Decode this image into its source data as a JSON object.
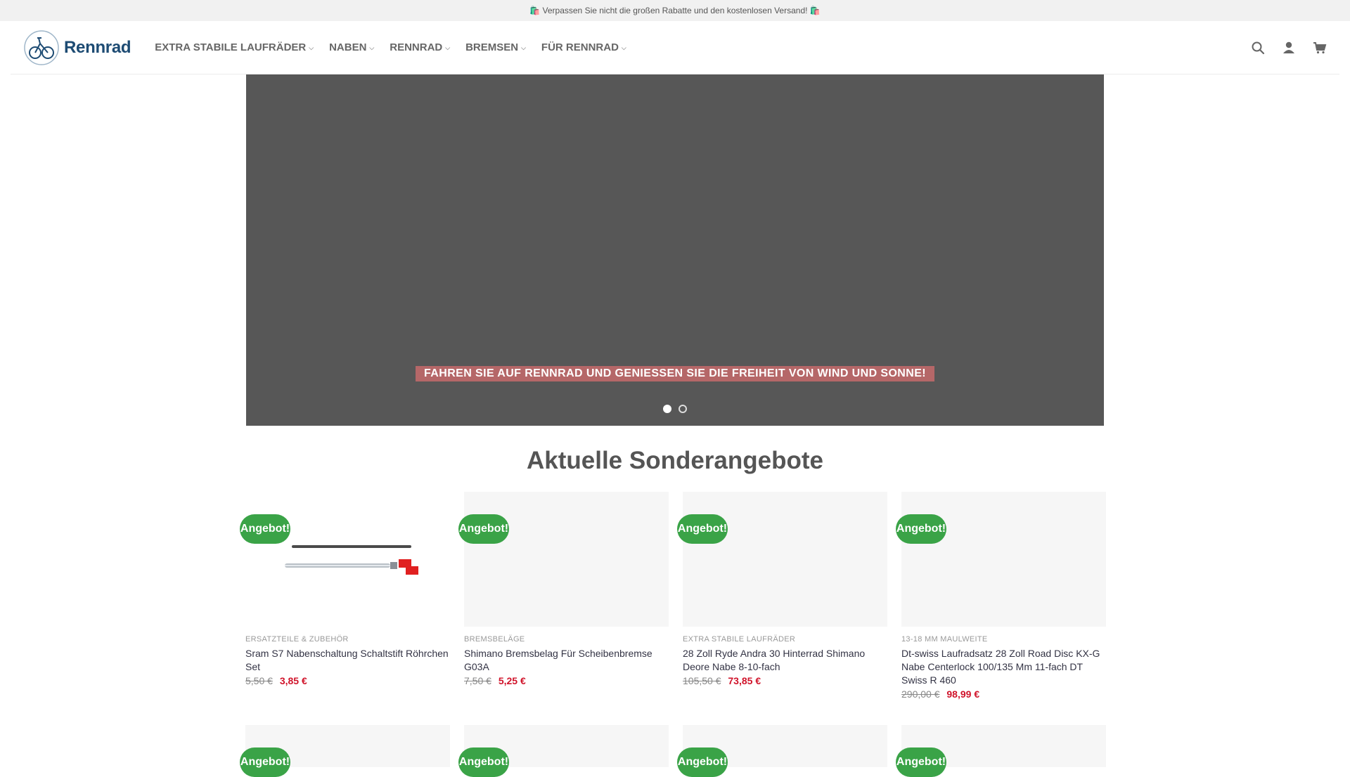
{
  "topbar": {
    "message": "🛍️ Verpassen Sie nicht die großen Rabatte und den kostenlosen Versand! 🛍️"
  },
  "logo": {
    "text": "Rennrad"
  },
  "nav": [
    {
      "label": "EXTRA STABILE LAUFRÄDER"
    },
    {
      "label": "NABEN"
    },
    {
      "label": "RENNRAD"
    },
    {
      "label": "BREMSEN"
    },
    {
      "label": "FÜR RENNRAD"
    }
  ],
  "header_icons": [
    "search-icon",
    "user-icon",
    "cart-icon"
  ],
  "hero": {
    "caption": "FAHREN SIE AUF RENNRAD UND GENIESSEN SIE DIE FREIHEIT VON WIND UND SONNE!",
    "slides": 2,
    "active_slide": 1
  },
  "section": {
    "title": "Aktuelle Sonderangebote"
  },
  "products": [
    {
      "badge": "Angebot!",
      "category": "ERSATZTEILE & ZUBEHÖR",
      "name": "Sram S7 Nabenschaltung Schaltstift Röhrchen Set",
      "old_price": "5,50 €",
      "new_price": "3,85 €"
    },
    {
      "badge": "Angebot!",
      "category": "BREMSBELÄGE",
      "name": "Shimano Bremsbelag Für Scheibenbremse G03A",
      "old_price": "7,50 €",
      "new_price": "5,25 €"
    },
    {
      "badge": "Angebot!",
      "category": "EXTRA STABILE LAUFRÄDER",
      "name": "28 Zoll Ryde Andra 30 Hinterrad Shimano Deore Nabe 8-10-fach",
      "old_price": "105,50 €",
      "new_price": "73,85 €"
    },
    {
      "badge": "Angebot!",
      "category": "13-18 MM MAULWEITE",
      "name": "Dt-swiss Laufradsatz 28 Zoll Road Disc KX-G Nabe Centerlock 100/135 Mm 11-fach DT Swiss R 460",
      "old_price": "290,00 €",
      "new_price": "98,99 €"
    }
  ],
  "products_row2": [
    {
      "badge": "Angebot!"
    },
    {
      "badge": "Angebot!"
    },
    {
      "badge": "Angebot!"
    },
    {
      "badge": "Angebot!"
    }
  ],
  "colors": {
    "badge": "#3aa347",
    "sale_price": "#d0132a",
    "hero_bg": "#575757",
    "caption_bg": "#b56768",
    "brand": "#1d4b73"
  }
}
